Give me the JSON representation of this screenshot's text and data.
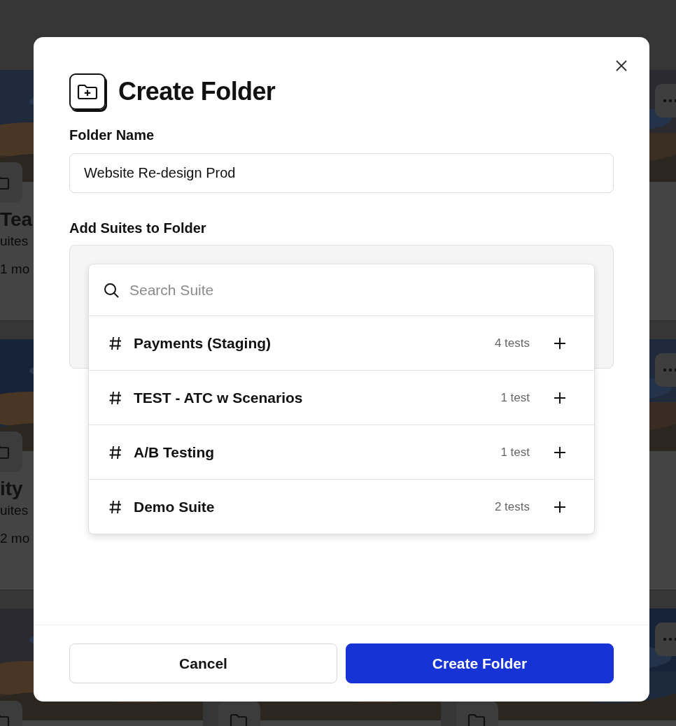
{
  "background": {
    "cards": [
      {
        "title": "Tea",
        "subtitle": "uites",
        "meta": "1 mo"
      },
      {
        "title": "ity",
        "subtitle": "uites",
        "meta": "2 mo"
      }
    ]
  },
  "dialog": {
    "title": "Create Folder",
    "name_label": "Folder Name",
    "name_value": "Website Re-design Prod",
    "suites_label": "Add Suites to Folder",
    "search": {
      "placeholder": "Search Suite"
    },
    "suites": [
      {
        "name": "Payments (Staging)",
        "count": "4 tests"
      },
      {
        "name": "TEST - ATC w Scenarios",
        "count": "1 test"
      },
      {
        "name": "A/B Testing",
        "count": "1 test"
      },
      {
        "name": "Demo Suite",
        "count": "2 tests"
      }
    ],
    "buttons": [
      {
        "label": "Cancel",
        "kind": "secondary"
      },
      {
        "label": "Create Folder",
        "kind": "primary"
      }
    ]
  }
}
